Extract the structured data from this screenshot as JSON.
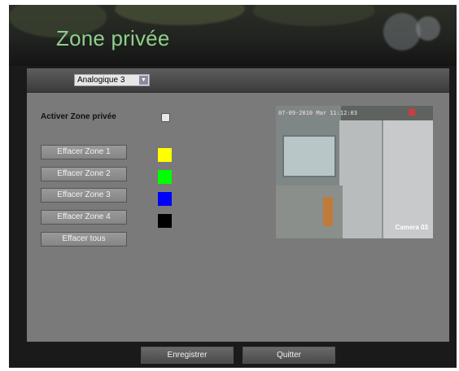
{
  "window": {
    "title": "Zone privée"
  },
  "toolbar": {
    "channel_select": {
      "value": "Analogique 3"
    }
  },
  "privacy": {
    "enable_label": "Activer Zone privée",
    "enable_checked": false,
    "zones": [
      {
        "button_label": "Effacer Zone 1",
        "color": "#ffff00"
      },
      {
        "button_label": "Effacer Zone 2",
        "color": "#00ff00"
      },
      {
        "button_label": "Effacer Zone 3",
        "color": "#0000ff"
      },
      {
        "button_label": "Effacer Zone 4",
        "color": "#000000"
      }
    ],
    "clear_all_label": "Effacer tous"
  },
  "preview": {
    "osd_timestamp": "07-09-2010 Mar 11:12:03",
    "osd_camera": "Camera 03"
  },
  "footer": {
    "save_label": "Enregistrer",
    "quit_label": "Quitter"
  }
}
